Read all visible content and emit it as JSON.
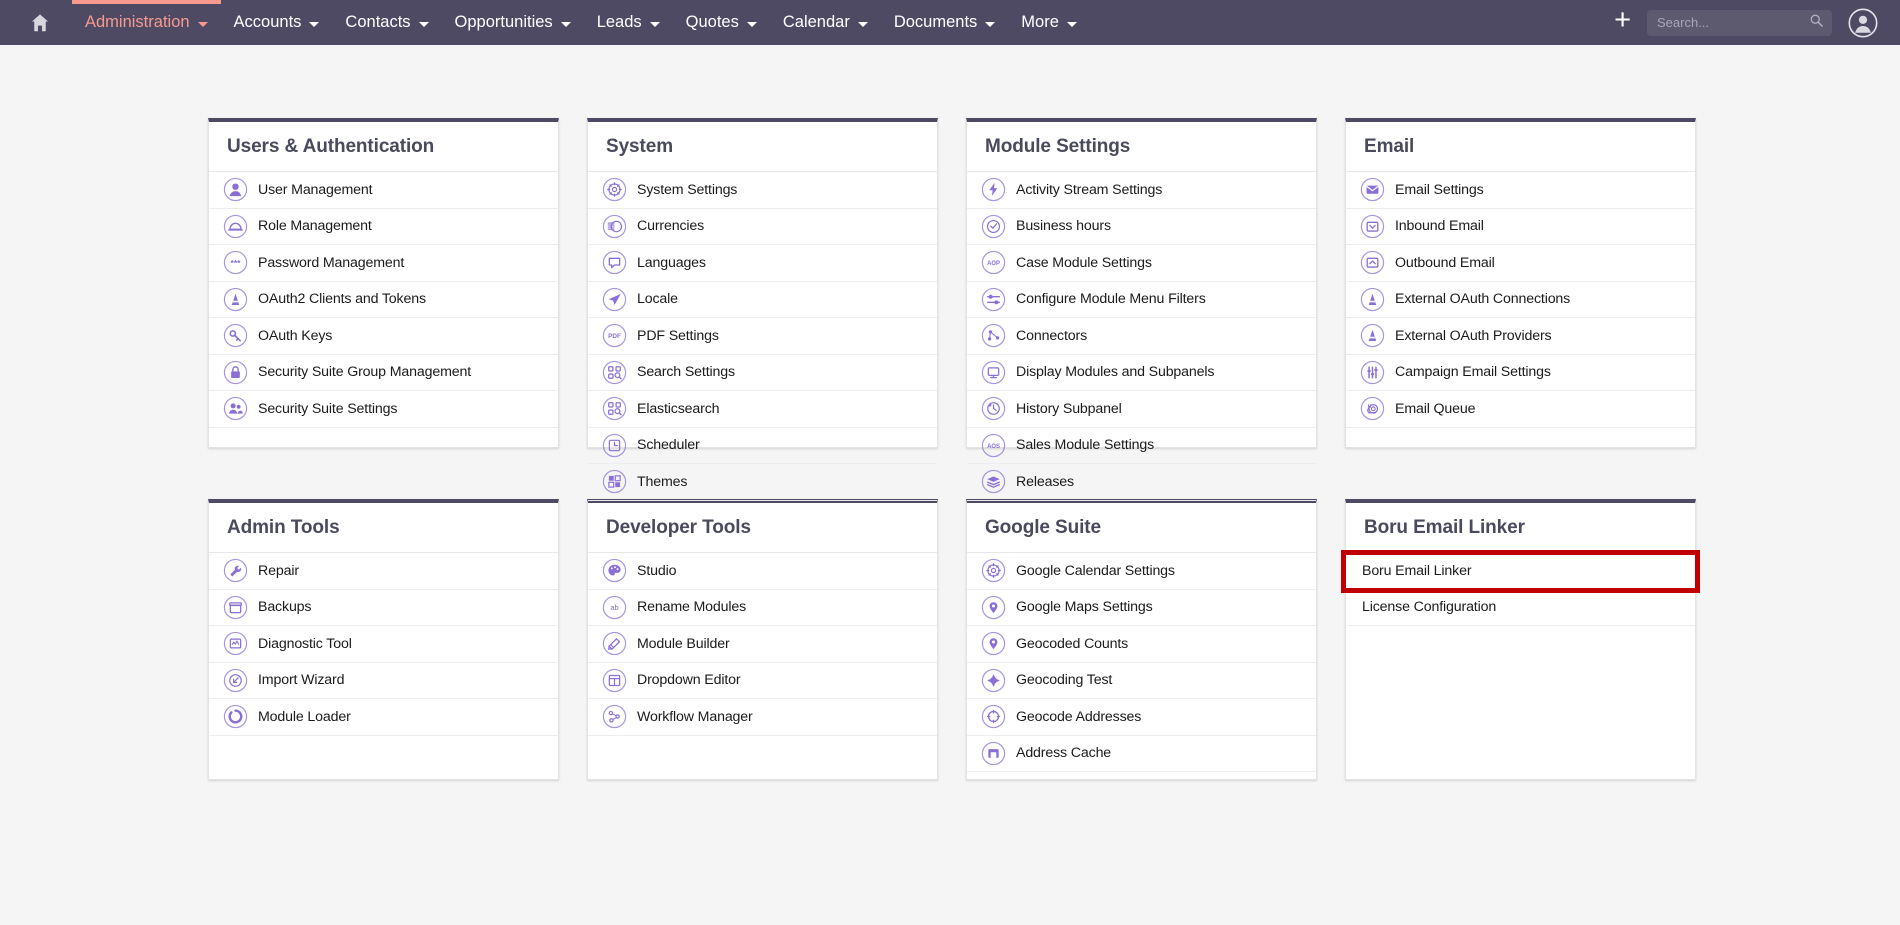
{
  "topnav": {
    "home_icon": "home-icon",
    "items": [
      {
        "label": "Administration",
        "active": true,
        "caret": true
      },
      {
        "label": "Accounts",
        "active": false,
        "caret": true
      },
      {
        "label": "Contacts",
        "active": false,
        "caret": true
      },
      {
        "label": "Opportunities",
        "active": false,
        "caret": true
      },
      {
        "label": "Leads",
        "active": false,
        "caret": true
      },
      {
        "label": "Quotes",
        "active": false,
        "caret": true
      },
      {
        "label": "Calendar",
        "active": false,
        "caret": true
      },
      {
        "label": "Documents",
        "active": false,
        "caret": true
      },
      {
        "label": "More",
        "active": false,
        "caret": true
      }
    ],
    "add_label": "+",
    "search": {
      "placeholder": "Search...",
      "value": "",
      "icon": "search-icon"
    },
    "avatar_icon": "user-avatar-icon",
    "colors": {
      "bar_background": "#4e4a63",
      "active_accent": "#f79a8e",
      "text": "#ffffff",
      "search_field": "#5d5a70"
    }
  },
  "theme": {
    "page_background": "#f5f5f5",
    "panel_background": "#ffffff",
    "panel_top_border": "#4e4a63",
    "panel_title_color": "#494a5c",
    "icon_color": "#8a6fd4",
    "highlight_color": "#c00000"
  },
  "panels": [
    {
      "title": "Users & Authentication",
      "items": [
        {
          "label": "User Management",
          "icon": "user-icon"
        },
        {
          "label": "Role Management",
          "icon": "role-hat-icon"
        },
        {
          "label": "Password Management",
          "icon": "asterisks-password-icon"
        },
        {
          "label": "OAuth2 Clients and Tokens",
          "icon": "oauth-a-icon"
        },
        {
          "label": "OAuth Keys",
          "icon": "key-icon"
        },
        {
          "label": "Security Suite Group Management",
          "icon": "padlock-icon"
        },
        {
          "label": "Security Suite Settings",
          "icon": "users-group-icon"
        }
      ]
    },
    {
      "title": "System",
      "items": [
        {
          "label": "System Settings",
          "icon": "gear-icon"
        },
        {
          "label": "Currencies",
          "icon": "coins-currency-icon"
        },
        {
          "label": "Languages",
          "icon": "speech-bubble-icon"
        },
        {
          "label": "Locale",
          "icon": "paper-plane-icon"
        },
        {
          "label": "PDF Settings",
          "icon": "pdf-icon"
        },
        {
          "label": "Search Settings",
          "icon": "search-grid-icon"
        },
        {
          "label": "Elasticsearch",
          "icon": "search-grid-icon"
        },
        {
          "label": "Scheduler",
          "icon": "clock-icon"
        },
        {
          "label": "Themes",
          "icon": "themes-squares-icon"
        }
      ]
    },
    {
      "title": "Module Settings",
      "items": [
        {
          "label": "Activity Stream Settings",
          "icon": "lightning-bolt-icon"
        },
        {
          "label": "Business hours",
          "icon": "clock-check-icon"
        },
        {
          "label": "Case Module Settings",
          "icon": "aop-text-icon"
        },
        {
          "label": "Configure Module Menu Filters",
          "icon": "sliders-filter-icon"
        },
        {
          "label": "Connectors",
          "icon": "connectors-node-icon"
        },
        {
          "label": "Display Modules and Subpanels",
          "icon": "monitor-icon"
        },
        {
          "label": "History Subpanel",
          "icon": "history-clock-icon"
        },
        {
          "label": "Sales Module Settings",
          "icon": "aos-text-icon"
        },
        {
          "label": "Releases",
          "icon": "layers-stack-icon"
        }
      ]
    },
    {
      "title": "Email",
      "items": [
        {
          "label": "Email Settings",
          "icon": "envelope-icon"
        },
        {
          "label": "Inbound Email",
          "icon": "inbox-down-icon"
        },
        {
          "label": "Outbound Email",
          "icon": "outbox-up-icon"
        },
        {
          "label": "External OAuth Connections",
          "icon": "oauth-a-icon"
        },
        {
          "label": "External OAuth Providers",
          "icon": "oauth-a-icon"
        },
        {
          "label": "Campaign Email Settings",
          "icon": "equalizer-icon"
        },
        {
          "label": "Email Queue",
          "icon": "snail-icon"
        }
      ]
    },
    {
      "title": "Admin Tools",
      "items": [
        {
          "label": "Repair",
          "icon": "wrench-icon"
        },
        {
          "label": "Backups",
          "icon": "archive-box-icon"
        },
        {
          "label": "Diagnostic Tool",
          "icon": "diagnostic-chart-icon"
        },
        {
          "label": "Import Wizard",
          "icon": "import-arrow-icon"
        },
        {
          "label": "Module Loader",
          "icon": "loader-spinner-icon"
        }
      ]
    },
    {
      "title": "Developer Tools",
      "items": [
        {
          "label": "Studio",
          "icon": "palette-icon"
        },
        {
          "label": "Rename Modules",
          "icon": "ab-text-icon"
        },
        {
          "label": "Module Builder",
          "icon": "module-builder-icon"
        },
        {
          "label": "Dropdown Editor",
          "icon": "layout-panel-icon"
        },
        {
          "label": "Workflow Manager",
          "icon": "workflow-nodes-icon"
        }
      ]
    },
    {
      "title": "Google Suite",
      "items": [
        {
          "label": "Google Calendar Settings",
          "icon": "gear-icon"
        },
        {
          "label": "Google Maps Settings",
          "icon": "map-pin-icon"
        },
        {
          "label": "Geocoded Counts",
          "icon": "map-pin-icon"
        },
        {
          "label": "Geocoding Test",
          "icon": "geocoding-target-icon"
        },
        {
          "label": "Geocode Addresses",
          "icon": "crosshair-circle-icon"
        },
        {
          "label": "Address Cache",
          "icon": "cache-box-icon"
        }
      ]
    },
    {
      "title": "Boru Email Linker",
      "highlighted_item_index": 0,
      "items": [
        {
          "label": "Boru Email Linker",
          "icon": null
        },
        {
          "label": "License Configuration",
          "icon": null
        }
      ]
    }
  ]
}
